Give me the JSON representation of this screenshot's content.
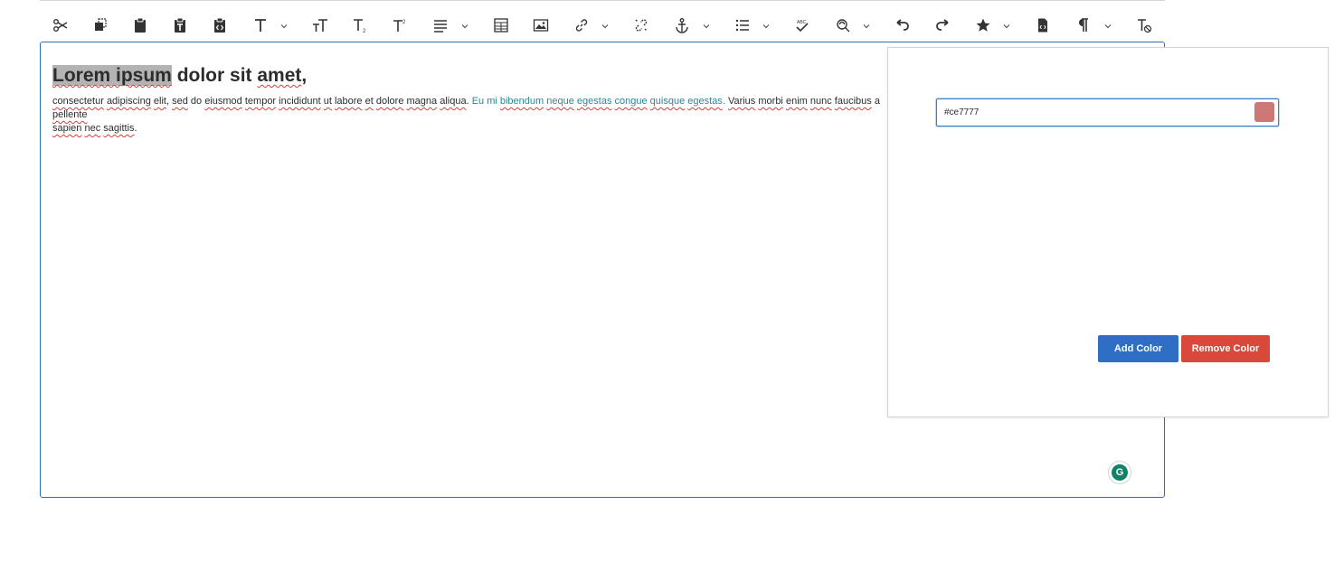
{
  "toolbar": {
    "icons": [
      "cut-icon",
      "copy-icon",
      "paste-icon",
      "paste-text-icon",
      "paste-html-icon",
      "text-style-icon",
      "text-size-icon",
      "subscript-icon",
      "superscript-icon",
      "align-icon",
      "table-icon",
      "image-icon",
      "link-icon",
      "unlink-icon",
      "anchor-icon",
      "list-icon",
      "spellcheck-icon",
      "find-replace-icon",
      "undo-icon",
      "redo-icon",
      "special-char-icon",
      "source-edit-icon",
      "paragraph-icon",
      "clear-format-icon"
    ]
  },
  "editor": {
    "heading": {
      "highlighted": "Lorem ipsum",
      "rest_a": " dolor sit ",
      "amet": "amet",
      "comma": ","
    },
    "paragraph": {
      "w1": "consectetur",
      "w2": "adipiscing",
      "w3": "elit",
      "c1": ",",
      "w4": "sed",
      "s1": " do ",
      "w5": "eiusmod",
      "w6": "tempor",
      "w7": "incididunt",
      "w8": "ut",
      "w9": "labore",
      "w10": "et",
      "w11": "dolore",
      "w12": "magna",
      "w13": "aliqua",
      "dot1": ".",
      "t_eu": "Eu mi",
      "t_bibendum": "bibendum",
      "t_neque": "neque",
      "t_egestas1": "egestas",
      "t_congue": "congue",
      "t_quisque": "quisque",
      "t_egestas2": "egestas",
      "dot2": ".",
      "v1": "Varius",
      "v2": "morbi",
      "v3": "enim",
      "v4": "nunc",
      "v5": "faucibus",
      "v6": " a ",
      "v7": "pellente",
      "l2a": "sapien",
      "l2b": "nec",
      "l2c": "sagittis",
      "dot3": "."
    },
    "grammarly_letter": "G"
  },
  "color_popup": {
    "input_value": "#ce7777",
    "swatch_color": "#ce7777",
    "add_label": "Add Color",
    "remove_label": "Remove Color",
    "add_color": "#2f6ec5",
    "remove_color": "#d8493b"
  }
}
